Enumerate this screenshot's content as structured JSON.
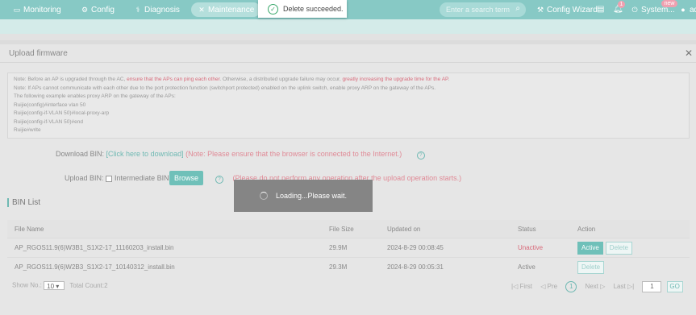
{
  "nav": {
    "items": [
      {
        "label": "Monitoring",
        "icon": "monitor-icon"
      },
      {
        "label": "Config",
        "icon": "gear-icon"
      },
      {
        "label": "Diagnosis",
        "icon": "diagnosis-icon"
      },
      {
        "label": "Maintenance",
        "icon": "wrench-icon"
      }
    ],
    "search_placeholder": "Enter a search term",
    "config_wizard": "Config Wizard",
    "bell_badge": "1",
    "system": "System...",
    "new_badge": "new",
    "user": "ad"
  },
  "toast": {
    "message": "Delete succeeded."
  },
  "panel": {
    "title": "Upload firmware",
    "note": {
      "l1_a": "Note: Before an AP is upgraded through the AC, ",
      "l1_b": "ensure that the APs can ping each other",
      "l1_c": ". Otherwise, a distributed upgrade failure may occur, ",
      "l1_d": "greatly increasing the upgrade time for the AP",
      "l1_e": ".",
      "l2": "Note: If APs cannot communicate with each other due to the port protection function (switchport protected) enabled on the uplink switch, enable proxy ARP on the gateway of the APs.",
      "l3": "The following example enables proxy ARP on the gateway of the APs:",
      "l4": "Ruijie(config)#interface vlan 50",
      "l5": "Ruijie(config-if-VLAN 50)#local-proxy-arp",
      "l6": "Ruijie(config-if-VLAN 50)#end",
      "l7": "Ruijie#write"
    },
    "download_label": "Download BIN:",
    "download_link": "[Click here to download]",
    "download_note": "(Note: Please ensure that the browser is connected to the Internet.)",
    "upload_label": "Upload BIN:",
    "intermediate_label": "Intermediate BIN",
    "browse": "Browse",
    "upload_note": "(Please do not perform any operation after the upload operation starts.)"
  },
  "bin_list": {
    "title": "BIN List",
    "columns": [
      "File Name",
      "File Size",
      "Updated on",
      "Status",
      "Action"
    ],
    "rows": [
      {
        "name": "AP_RGOS11.9(6)W3B1_S1X2-17_11160203_install.bin",
        "size": "29.9M",
        "updated": "2024-8-29 00:08:45",
        "status": "Unactive",
        "active_label": "Active",
        "delete_label": "Delete"
      },
      {
        "name": "AP_RGOS11.9(6)W2B3_S1X2-17_10140312_install.bin",
        "size": "29.3M",
        "updated": "2024-8-29 00:05:31",
        "status": "Active",
        "delete_label": "Delete"
      }
    ]
  },
  "footer": {
    "show_no": "Show No.:",
    "page_size": "10",
    "total": "Total Count:2"
  },
  "pager": {
    "first": "First",
    "prev": "Pre",
    "current": "1",
    "next": "Next",
    "last": "Last",
    "page_input": "1",
    "go": "GO"
  },
  "loading": {
    "message": "Loading...Please wait."
  },
  "colors": {
    "accent": "#87c9c5",
    "button": "#6fc0b9",
    "warning": "#d86a7a"
  }
}
